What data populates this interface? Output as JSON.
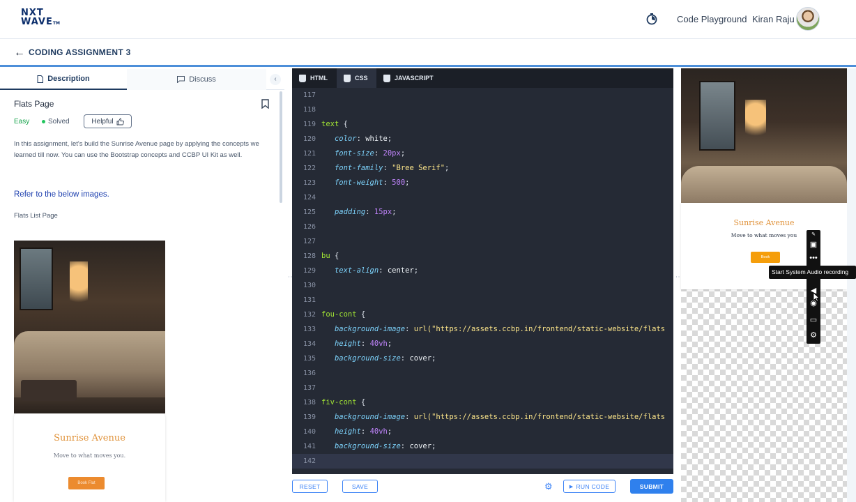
{
  "header": {
    "logo_line1": "NXT",
    "logo_line2": "WAVE",
    "logo_tm": "TM",
    "playground_link": "Code Playground",
    "user_name": "Kiran Raju"
  },
  "subheader": {
    "title": "CODING ASSIGNMENT 3"
  },
  "left_panel": {
    "tabs": [
      "Description",
      "Discuss"
    ],
    "problem_title": "Flats Page",
    "difficulty": "Easy",
    "status": "Solved",
    "helpful_label": "Helpful",
    "description": "In this assignment, let's build the Sunrise Avenue page by applying the concepts we learned till now. You can use the Bootstrap concepts and CCBP UI Kit as well.",
    "refer_text": "Refer to the below images.",
    "subheading": "Flats List Page",
    "image_card": {
      "title": "Sunrise Avenue",
      "subtitle": "Move to what moves you.",
      "button": "Book Flat"
    }
  },
  "editor": {
    "tabs": [
      "HTML",
      "CSS",
      "JAVASCRIPT"
    ],
    "active_tab": "CSS",
    "lines": [
      {
        "n": "117",
        "t": ""
      },
      {
        "n": "118",
        "t": ""
      },
      {
        "n": "119",
        "sel": "text",
        "t": " {"
      },
      {
        "n": "120",
        "prop": "color",
        "v": "white",
        "vt": "kw"
      },
      {
        "n": "121",
        "prop": "font-size",
        "v": "20px",
        "vt": "num"
      },
      {
        "n": "122",
        "prop": "font-family",
        "v": "\"Bree Serif\"",
        "vt": "str"
      },
      {
        "n": "123",
        "prop": "font-weight",
        "v": "500",
        "vt": "num"
      },
      {
        "n": "124",
        "t": ""
      },
      {
        "n": "125",
        "prop": "padding",
        "v": "15px",
        "vt": "num"
      },
      {
        "n": "126",
        "t": ""
      },
      {
        "n": "127",
        "t": ""
      },
      {
        "n": "128",
        "sel": "bu",
        "t": " {"
      },
      {
        "n": "129",
        "prop": "text-align",
        "v": "center",
        "vt": "kw"
      },
      {
        "n": "130",
        "t": ""
      },
      {
        "n": "131",
        "t": ""
      },
      {
        "n": "132",
        "sel": "fou-cont",
        "t": " {"
      },
      {
        "n": "133",
        "prop": "background-image",
        "v": "url(\"https://assets.ccbp.in/frontend/static-website/flats",
        "vt": "str"
      },
      {
        "n": "134",
        "prop": "height",
        "v": "40vh",
        "vt": "num"
      },
      {
        "n": "135",
        "prop": "background-size",
        "v": "cover",
        "vt": "kw"
      },
      {
        "n": "136",
        "t": ""
      },
      {
        "n": "137",
        "t": ""
      },
      {
        "n": "138",
        "sel": "fiv-cont",
        "t": " {"
      },
      {
        "n": "139",
        "prop": "background-image",
        "v": "url(\"https://assets.ccbp.in/frontend/static-website/flats",
        "vt": "str"
      },
      {
        "n": "140",
        "prop": "height",
        "v": "40vh",
        "vt": "num"
      },
      {
        "n": "141",
        "prop": "background-size",
        "v": "cover",
        "vt": "kw"
      },
      {
        "n": "142",
        "t": "",
        "active": true
      }
    ],
    "buttons": {
      "reset": "RESET",
      "save": "SAVE",
      "run": "RUN CODE",
      "submit": "SUBMIT"
    }
  },
  "preview": {
    "title": "Sunrise Avenue",
    "subtitle": "Move to what moves you",
    "button": "Book"
  },
  "overlay": {
    "tooltip": "Start System Audio recording"
  },
  "colors": {
    "accent_blue": "#2f80ed",
    "editor_bg": "#252a35",
    "brand_orange": "#e0923a"
  }
}
